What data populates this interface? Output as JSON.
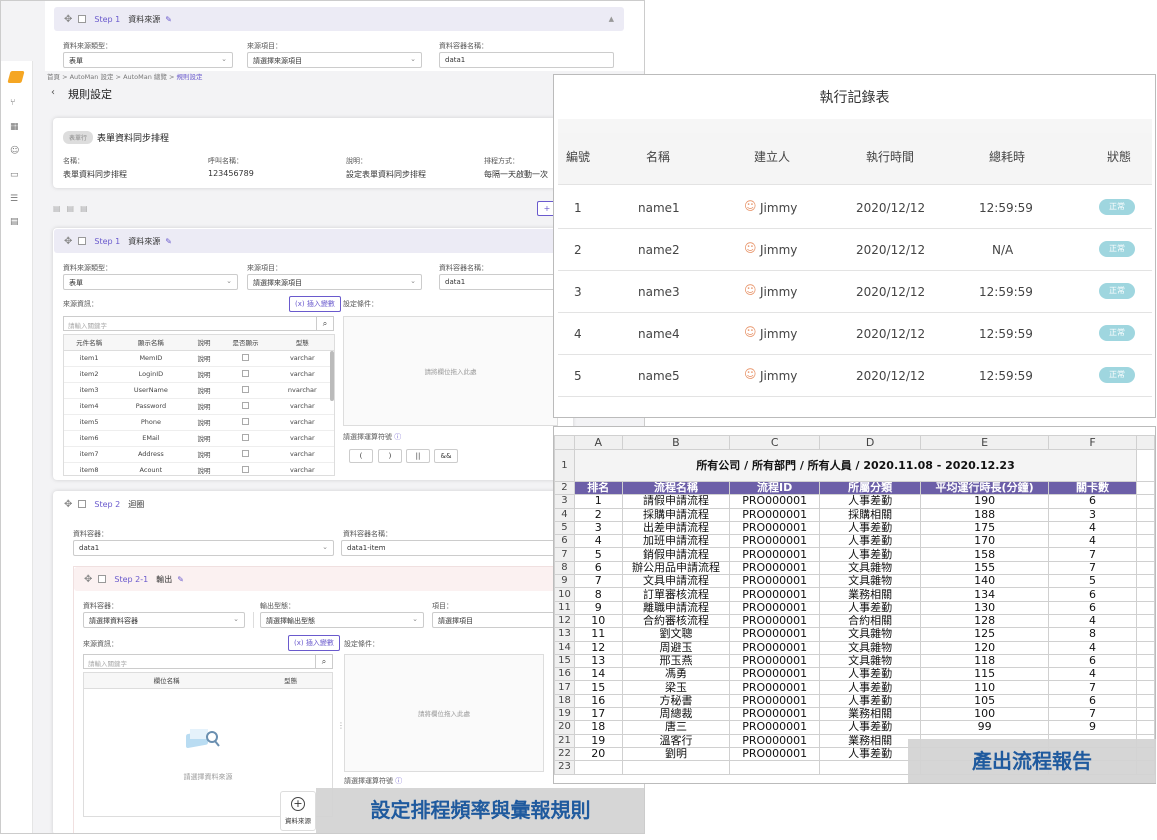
{
  "top_step": {
    "step": "Step 1",
    "name": "資料來源",
    "label1": "資料來源類型：",
    "val1": "表單",
    "label2": "來源項目：",
    "val2": "請選擇來源項目",
    "label3": "資料容器名稱：",
    "val3": "data1"
  },
  "breadcrumb": [
    "首頁",
    "AutoMan 設定",
    "AutoMan 總覽",
    "規則設定"
  ],
  "page_title": "規則設定",
  "rule": {
    "tag": "表單行",
    "name": "表單資料同步排程",
    "fields": [
      {
        "label": "名稱：",
        "value": "表單資料同步排程"
      },
      {
        "label": "呼叫名稱：",
        "value": "123456789"
      },
      {
        "label": "說明：",
        "value": "設定表單資料同步排程"
      },
      {
        "label": "排程方式：",
        "value": "每隔一天啟動一次"
      }
    ]
  },
  "step1": {
    "step": "Step 1",
    "name": "資料來源",
    "type_label": "資料來源類型：",
    "type_val": "表單",
    "item_label": "來源項目：",
    "item_val": "請選擇來源項目",
    "container_label": "資料容器名稱：",
    "container_val": "data1",
    "source_label": "來源資訊：",
    "insert_btn": "(x) 插入變數",
    "search_ph": "請輸入關鍵字",
    "cond_label": "設定條件：",
    "drop_text": "請將欄位拖入此處",
    "op_label": "請選擇運算符號",
    "ops": [
      "(",
      ")",
      "||",
      "&&"
    ],
    "cols": [
      "元件名稱",
      "顯示名稱",
      "說明",
      "是否顯示",
      "型態"
    ],
    "rows": [
      [
        "item1",
        "MemID",
        "說明",
        "varchar"
      ],
      [
        "item2",
        "LoginID",
        "說明",
        "varchar"
      ],
      [
        "item3",
        "UserName",
        "說明",
        "nvarchar"
      ],
      [
        "item4",
        "Password",
        "說明",
        "varchar"
      ],
      [
        "item5",
        "Phone",
        "說明",
        "varchar"
      ],
      [
        "item6",
        "EMail",
        "說明",
        "varchar"
      ],
      [
        "item7",
        "Address",
        "說明",
        "varchar"
      ],
      [
        "item8",
        "Acount",
        "說明",
        "varchar"
      ]
    ]
  },
  "step2": {
    "step": "Step 2",
    "name": "迴圈",
    "c_label": "資料容器：",
    "c_val": "data1",
    "cn_label": "資料容器名稱：",
    "cn_val": "data1-item"
  },
  "step21": {
    "step": "Step 2-1",
    "name": "輸出",
    "c_label": "資料容器：",
    "c_val": "請選擇資料容器",
    "o_label": "輸出型態：",
    "o_val": "請選擇輸出型態",
    "i_label": "項目：",
    "i_val": "請選擇項目",
    "source_label": "來源資訊：",
    "insert_btn": "(x) 插入變數",
    "search_ph": "請輸入關鍵字",
    "cond_label": "設定條件：",
    "drop_text": "請將欄位拖入此處",
    "col1": "欄位名稱",
    "col2": "型態",
    "empty": "請選擇資料來源",
    "op_label": "請選擇運算符號"
  },
  "add_source": "資料來源",
  "banner_left": "設定排程頻率與彙報規則",
  "banner_right": "產出流程報告",
  "log": {
    "title": "執行記錄表",
    "headers": [
      "編號",
      "名稱",
      "建立人",
      "執行時間",
      "總耗時",
      "狀態"
    ],
    "rows": [
      [
        "1",
        "name1",
        "Jimmy",
        "2020/12/12",
        "12:59:59",
        "正常"
      ],
      [
        "2",
        "name2",
        "Jimmy",
        "2020/12/12",
        "N/A",
        "正常"
      ],
      [
        "3",
        "name3",
        "Jimmy",
        "2020/12/12",
        "12:59:59",
        "正常"
      ],
      [
        "4",
        "name4",
        "Jimmy",
        "2020/12/12",
        "12:59:59",
        "正常"
      ],
      [
        "5",
        "name5",
        "Jimmy",
        "2020/12/12",
        "12:59:59",
        "正常"
      ]
    ]
  },
  "sheet": {
    "col_letters": [
      "A",
      "B",
      "C",
      "D",
      "E",
      "F"
    ],
    "title": "所有公司 / 所有部門 / 所有人員 / 2020.11.08 - 2020.12.23",
    "headers": [
      "排名",
      "流程名稱",
      "流程ID",
      "所屬分類",
      "平均運行時長(分鐘)",
      "關卡數"
    ],
    "rows": [
      [
        "1",
        "請假申請流程",
        "PRO000001",
        "人事差勤",
        "190",
        "6"
      ],
      [
        "2",
        "採購申請流程",
        "PRO000001",
        "採購相關",
        "188",
        "3"
      ],
      [
        "3",
        "出差申請流程",
        "PRO000001",
        "人事差勤",
        "175",
        "4"
      ],
      [
        "4",
        "加班申請流程",
        "PRO000001",
        "人事差勤",
        "170",
        "4"
      ],
      [
        "5",
        "銷假申請流程",
        "PRO000001",
        "人事差勤",
        "158",
        "7"
      ],
      [
        "6",
        "辦公用品申請流程",
        "PRO000001",
        "文具雜物",
        "155",
        "7"
      ],
      [
        "7",
        "文具申請流程",
        "PRO000001",
        "文具雜物",
        "140",
        "5"
      ],
      [
        "8",
        "訂單審核流程",
        "PRO000001",
        "業務相關",
        "134",
        "6"
      ],
      [
        "9",
        "離職申請流程",
        "PRO000001",
        "人事差勤",
        "130",
        "6"
      ],
      [
        "10",
        "合約審核流程",
        "PRO000001",
        "合約相關",
        "128",
        "4"
      ],
      [
        "11",
        "劉文聰",
        "PRO000001",
        "文具雜物",
        "125",
        "8"
      ],
      [
        "12",
        "周避玉",
        "PRO000001",
        "文具雜物",
        "120",
        "4"
      ],
      [
        "13",
        "邢玉燕",
        "PRO000001",
        "文具雜物",
        "118",
        "6"
      ],
      [
        "14",
        "馮勇",
        "PRO000001",
        "人事差勤",
        "115",
        "4"
      ],
      [
        "15",
        "梁玉",
        "PRO000001",
        "人事差勤",
        "110",
        "7"
      ],
      [
        "16",
        "方秘書",
        "PRO000001",
        "人事差勤",
        "105",
        "6"
      ],
      [
        "17",
        "周總裁",
        "PRO000001",
        "業務相關",
        "100",
        "7"
      ],
      [
        "18",
        "唐三",
        "PRO000001",
        "人事差勤",
        "99",
        "9"
      ],
      [
        "19",
        "溫客行",
        "PRO000001",
        "業務相關",
        "",
        ""
      ],
      [
        "20",
        "劉明",
        "PRO000001",
        "人事差勤",
        "",
        ""
      ]
    ]
  }
}
